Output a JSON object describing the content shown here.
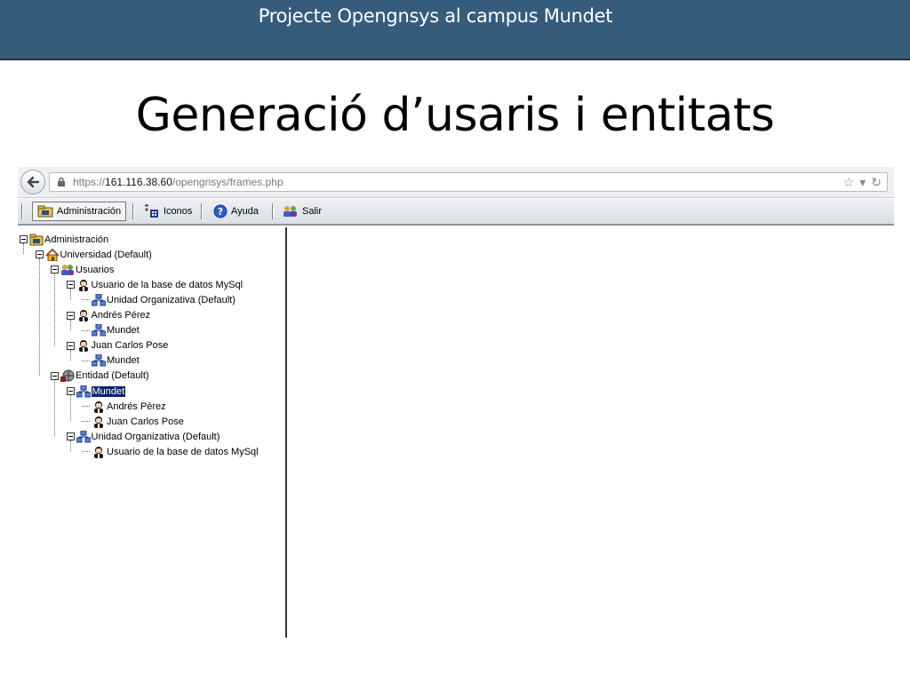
{
  "slide": {
    "header_title": "Projecte Opengnsys al campus Mundet",
    "title": "Generació d’usaris i entitats"
  },
  "browser": {
    "url_scheme": "https://",
    "url_host": "161.116.38.60",
    "url_path": "/opengnsys/frames.php",
    "star_icon": "☆",
    "dropdown_icon": "▾",
    "reload_icon": "↻"
  },
  "toolbar": {
    "items": [
      {
        "label": "Administración",
        "icon": "admin-icon"
      },
      {
        "label": "Iconos",
        "icon": "icons-view-icon"
      },
      {
        "label": "Ayuda",
        "icon": "help-icon"
      },
      {
        "label": "Salir",
        "icon": "exit-icon"
      }
    ]
  },
  "tree": {
    "nodes": [
      {
        "label": "Administración",
        "icon": "admin-icon",
        "depth": 0
      },
      {
        "label": "Universidad (Default)",
        "icon": "house-icon",
        "depth": 1
      },
      {
        "label": "Usuarios",
        "icon": "users-icon",
        "depth": 2
      },
      {
        "label": "Usuario de la base de datos MySql",
        "icon": "user-icon",
        "depth": 3
      },
      {
        "label": "Unidad Organizativa (Default)",
        "icon": "org-unit-icon",
        "depth": 4
      },
      {
        "label": "Andrés Pérez",
        "icon": "user-icon",
        "depth": 3
      },
      {
        "label": "Mundet",
        "icon": "org-unit-icon",
        "depth": 4
      },
      {
        "label": "Juan Carlos Pose",
        "icon": "user-icon",
        "depth": 3
      },
      {
        "label": "Mundet",
        "icon": "org-unit-icon",
        "depth": 4
      },
      {
        "label": "Entidad (Default)",
        "icon": "entity-icon",
        "depth": 2
      },
      {
        "label": "Mundet",
        "icon": "org-unit-icon",
        "depth": 3,
        "selected": true
      },
      {
        "label": "Andrés Pérez",
        "icon": "user-icon",
        "depth": 4
      },
      {
        "label": "Juan Carlos Pose",
        "icon": "user-icon",
        "depth": 4
      },
      {
        "label": "Unidad Organizativa (Default)",
        "icon": "org-unit-icon",
        "depth": 3
      },
      {
        "label": "Usuario de la base de datos MySql",
        "icon": "user-icon",
        "depth": 4
      }
    ]
  }
}
